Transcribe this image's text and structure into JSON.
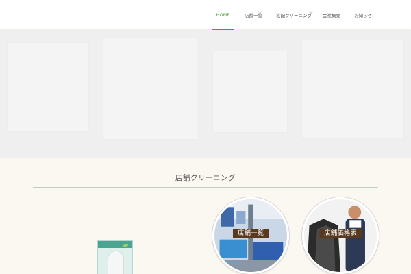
{
  "nav": {
    "items": [
      {
        "label": "HOME",
        "active": true
      },
      {
        "label": "店舗一覧",
        "has_submenu": true
      },
      {
        "label": "宅配クリーニング",
        "has_submenu": true
      },
      {
        "label": "会社概要"
      },
      {
        "label": "お知らせ"
      }
    ]
  },
  "section": {
    "title": "店舗クリーニング"
  },
  "cards": [
    {
      "label": "店舗一覧"
    },
    {
      "label": "店舗価格表"
    }
  ],
  "colors": {
    "accent": "#4a9a3a",
    "label_bg": "#5a3a1f",
    "page_bg": "#fbf8f2",
    "hero_bg": "#efefef"
  }
}
